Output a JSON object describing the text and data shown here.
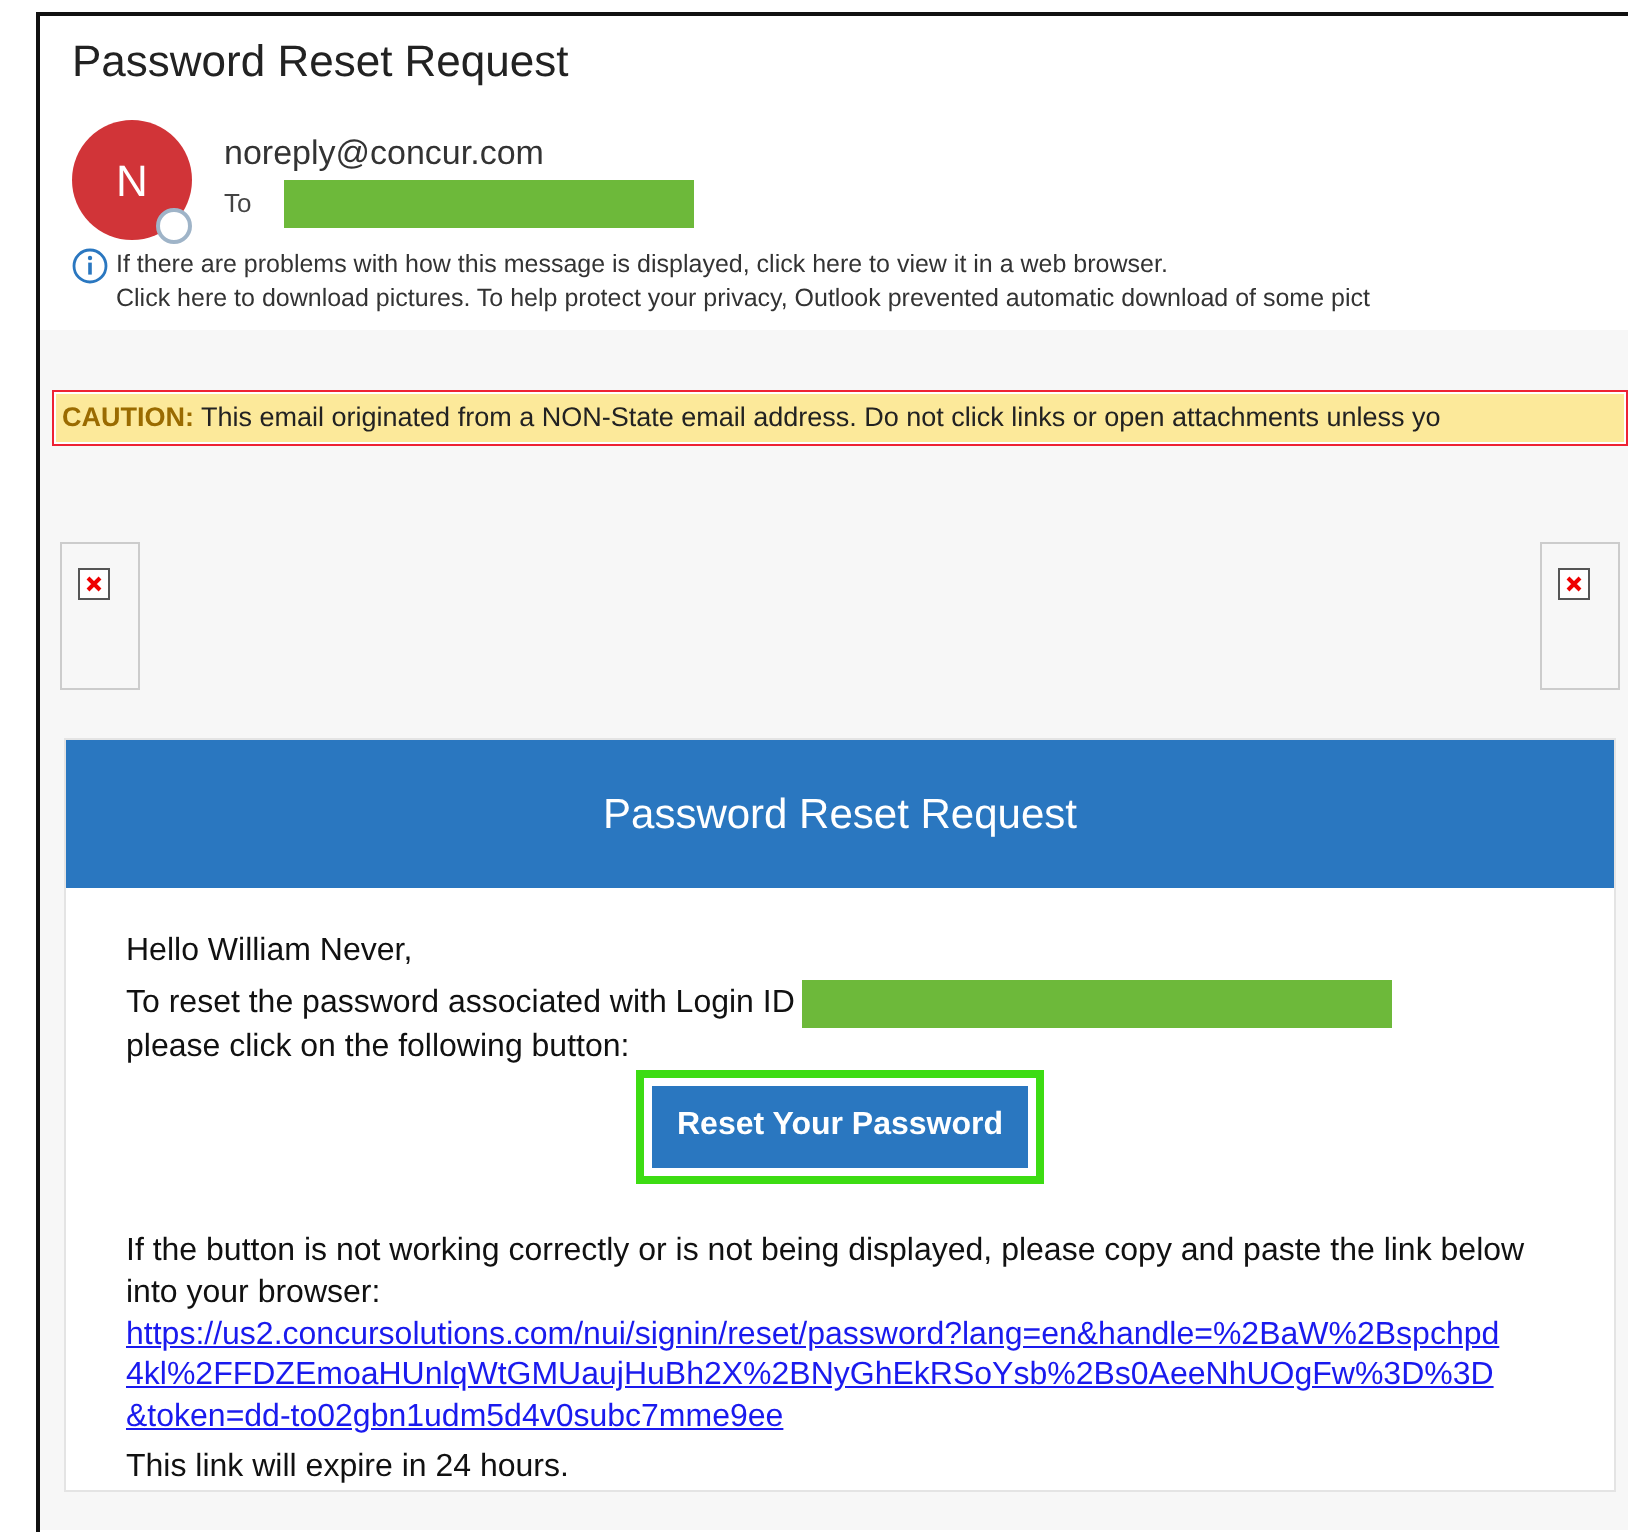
{
  "message": {
    "subject": "Password Reset Request",
    "sender": {
      "initial": "N",
      "address": "noreply@concur.com"
    },
    "to_label": "To",
    "info_lines": [
      "If there are problems with how this message is displayed, click here to view it in a web browser.",
      "Click here to download pictures. To help protect your privacy, Outlook prevented automatic download of some pict"
    ]
  },
  "caution": {
    "label": "CAUTION:",
    "text": "This email originated from a NON-State email address. Do not click links or open attachments unless yo"
  },
  "email": {
    "header_title": "Password Reset Request",
    "greeting": "Hello William Never,",
    "intro": "To reset the password associated with Login ID",
    "intro_2": "please click on the following button:",
    "button": "Reset Your Password",
    "fallback_text": "If the button is not working correctly or is not being displayed, please copy and paste the link below into your browser:",
    "link": "https://us2.concursolutions.com/nui/signin/reset/password?lang=en&handle=%2BaW%2Bspchpd4kl%2FFDZEmoaHUnlqWtGMUaujHuBh2X%2BNyGhEkRSoYsb%2Bs0AeeNhUOgFw%3D%3D&token=dd-to02gbn1udm5d4v0subc7mme9ee",
    "expiry": "This link will expire in 24 hours."
  }
}
